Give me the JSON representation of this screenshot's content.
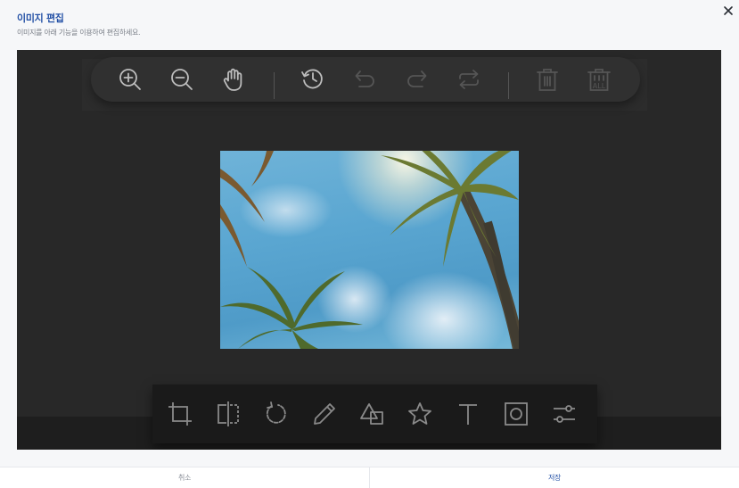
{
  "dialog": {
    "title": "이미지 편집",
    "subtitle": "이미지를 아래 기능을 이용하여 편집하세요.",
    "close_icon": "close-icon"
  },
  "top_toolbar": {
    "items": [
      {
        "name": "zoom-in",
        "icon": "zoom-in-icon",
        "enabled": true
      },
      {
        "name": "zoom-out",
        "icon": "zoom-out-icon",
        "enabled": true
      },
      {
        "name": "hand",
        "icon": "hand-icon",
        "enabled": true
      },
      {
        "name": "history",
        "icon": "history-icon",
        "enabled": true
      },
      {
        "name": "undo",
        "icon": "undo-icon",
        "enabled": false
      },
      {
        "name": "redo",
        "icon": "redo-icon",
        "enabled": false
      },
      {
        "name": "reset",
        "icon": "reset-icon",
        "enabled": false
      },
      {
        "name": "delete",
        "icon": "trash-icon",
        "enabled": false
      },
      {
        "name": "delete-all",
        "icon": "trash-all-icon",
        "enabled": false,
        "label": "ALL"
      }
    ]
  },
  "bottom_toolbar": {
    "items": [
      {
        "name": "crop",
        "icon": "crop-icon"
      },
      {
        "name": "flip",
        "icon": "flip-icon"
      },
      {
        "name": "rotate",
        "icon": "rotate-icon"
      },
      {
        "name": "draw",
        "icon": "pencil-icon"
      },
      {
        "name": "shape",
        "icon": "shape-icon"
      },
      {
        "name": "icon",
        "icon": "star-icon"
      },
      {
        "name": "text",
        "icon": "text-icon"
      },
      {
        "name": "mask",
        "icon": "mask-icon"
      },
      {
        "name": "filter",
        "icon": "filter-icon"
      }
    ]
  },
  "canvas": {
    "image": "palm-trees-sky-photo"
  },
  "footer": {
    "cancel_label": "취소",
    "save_label": "저장"
  },
  "colors": {
    "accent": "#2451a6",
    "editor_bg": "#282828",
    "icon_active": "#bdbdbd",
    "icon_disabled": "#555555"
  }
}
